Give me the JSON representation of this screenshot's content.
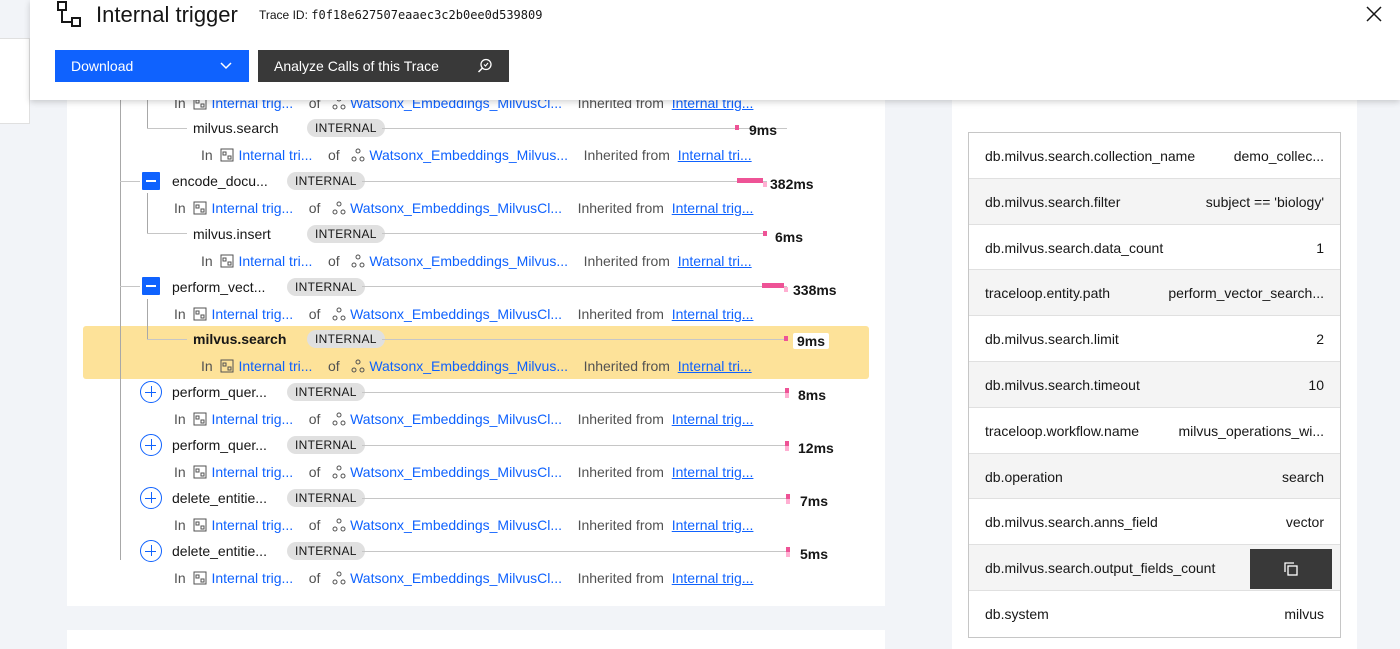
{
  "header": {
    "title": "Internal trigger",
    "trace_id_label": "Trace ID:",
    "trace_id": "f0f18e627507eaaec3c2b0ee0d539809",
    "download_label": "Download",
    "analyze_label": "Analyze Calls of this Trace"
  },
  "colors": {
    "primary": "#0f62fe",
    "bar": "#ee5396",
    "highlight": "#fde299"
  },
  "common": {
    "in": "In",
    "of": "of",
    "inherited_from": "Inherited from",
    "internal_tag": "INTERNAL"
  },
  "sub_rows": [
    {
      "svc": "Internal trig...",
      "app": "Watsonx_Embeddings_MilvusCl...",
      "inh": "Internal trig..."
    },
    {
      "svc": "Internal tri...",
      "app": "Watsonx_Embeddings_Milvus...",
      "inh": "Internal tri..."
    },
    {
      "svc": "Internal trig...",
      "app": "Watsonx_Embeddings_MilvusCl...",
      "inh": "Internal trig..."
    },
    {
      "svc": "Internal tri...",
      "app": "Watsonx_Embeddings_Milvus...",
      "inh": "Internal tri..."
    },
    {
      "svc": "Internal trig...",
      "app": "Watsonx_Embeddings_MilvusCl...",
      "inh": "Internal trig..."
    },
    {
      "svc": "Internal tri...",
      "app": "Watsonx_Embeddings_Milvus...",
      "inh": "Internal tri..."
    },
    {
      "svc": "Internal trig...",
      "app": "Watsonx_Embeddings_MilvusCl...",
      "inh": "Internal trig..."
    },
    {
      "svc": "Internal trig...",
      "app": "Watsonx_Embeddings_MilvusCl...",
      "inh": "Internal trig..."
    },
    {
      "svc": "Internal trig...",
      "app": "Watsonx_Embeddings_MilvusCl...",
      "inh": "Internal trig..."
    },
    {
      "svc": "Internal trig...",
      "app": "Watsonx_Embeddings_MilvusCl...",
      "inh": "Internal trig..."
    }
  ],
  "spans": [
    {
      "name": "milvus.search",
      "duration": "9ms"
    },
    {
      "name": "encode_docu...",
      "duration": "382ms"
    },
    {
      "name": "milvus.insert",
      "duration": "6ms"
    },
    {
      "name": "perform_vect...",
      "duration": "338ms"
    },
    {
      "name": "milvus.search",
      "duration": "9ms"
    },
    {
      "name": "perform_quer...",
      "duration": "8ms"
    },
    {
      "name": "perform_quer...",
      "duration": "12ms"
    },
    {
      "name": "delete_entitie...",
      "duration": "7ms"
    },
    {
      "name": "delete_entitie...",
      "duration": "5ms"
    }
  ],
  "attributes": [
    {
      "key": "db.milvus.search.collection_name",
      "value": "demo_collec..."
    },
    {
      "key": "db.milvus.search.filter",
      "value": "subject == 'biology'"
    },
    {
      "key": "db.milvus.search.data_count",
      "value": "1"
    },
    {
      "key": "traceloop.entity.path",
      "value": "perform_vector_search..."
    },
    {
      "key": "db.milvus.search.limit",
      "value": "2"
    },
    {
      "key": "db.milvus.search.timeout",
      "value": "10"
    },
    {
      "key": "traceloop.workflow.name",
      "value": "milvus_operations_wi..."
    },
    {
      "key": "db.operation",
      "value": "search"
    },
    {
      "key": "db.milvus.search.anns_field",
      "value": "vector"
    },
    {
      "key": "db.milvus.search.output_fields_count",
      "value": ""
    },
    {
      "key": "db.system",
      "value": "milvus"
    }
  ]
}
